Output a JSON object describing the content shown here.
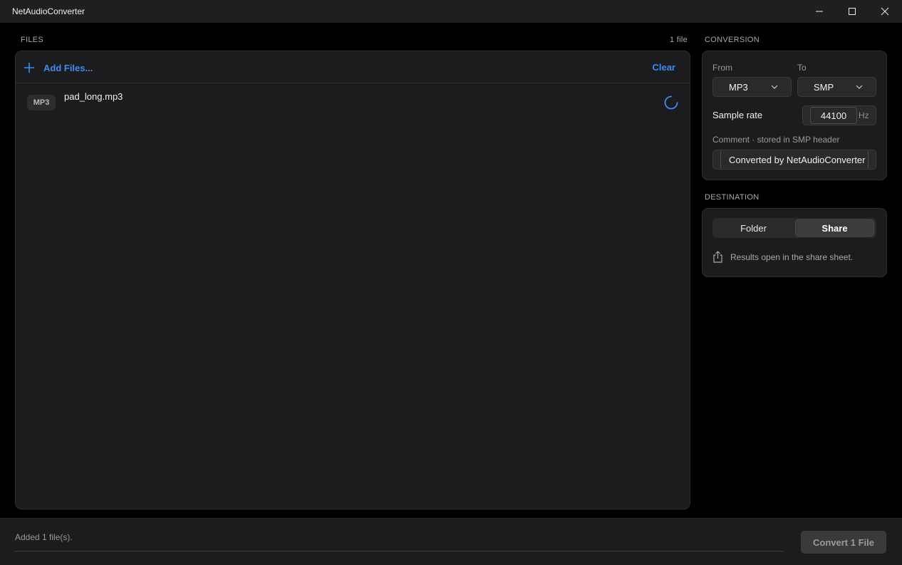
{
  "window": {
    "title": "NetAudioConverter",
    "controls": [
      "minimize-icon",
      "maximize-icon",
      "close-icon"
    ]
  },
  "files": {
    "section_label": "FILES",
    "count_label": "1 file",
    "add_label": "Add Files...",
    "clear_label": "Clear",
    "items": [
      {
        "format": "MP3",
        "name": "pad_long.mp3",
        "status_icon": "loading-spinner-icon"
      }
    ]
  },
  "conversion": {
    "section_label": "CONVERSION",
    "from_label": "From",
    "from_value": "MP3",
    "to_label": "To",
    "to_value": "SMP",
    "sample_rate_label": "Sample rate",
    "sample_rate_value": "44100",
    "sample_rate_unit": "Hz",
    "comment_label": "Comment · stored in SMP header",
    "comment_value": "Converted by NetAudioConverter"
  },
  "destination": {
    "section_label": "DESTINATION",
    "options": [
      "Folder",
      "Share"
    ],
    "selected": "Share",
    "info_text": "Results open in the share sheet.",
    "info_icon": "share-icon"
  },
  "status": {
    "message": "Added 1 file(s).",
    "convert_label": "Convert 1 File"
  },
  "colors": {
    "accent": "#3b8cf5",
    "background": "#000000",
    "panel": "#1c1c1e"
  }
}
